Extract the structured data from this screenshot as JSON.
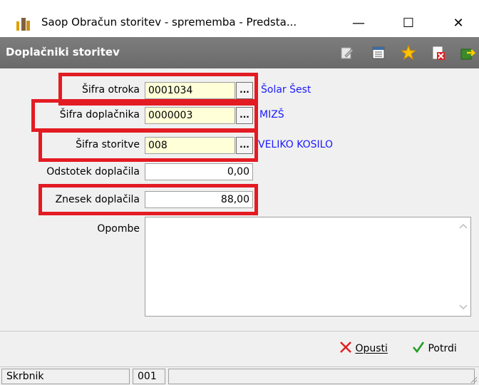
{
  "window": {
    "title": "Saop Obračun storitev - sprememba - Predsta...",
    "minimize": "—",
    "maximize": "☐",
    "close": "✕"
  },
  "header": {
    "title": "Doplačniki storitev",
    "toolbar_icons": [
      "edit-icon",
      "list-icon",
      "star-icon",
      "delete-document-icon",
      "exit-icon"
    ]
  },
  "form": {
    "child_code": {
      "label": "Šifra otroka",
      "value": "0001034",
      "lookup": "...",
      "description": "Šolar Šest"
    },
    "payer_code": {
      "label": "Šifra doplačnika",
      "value": "0000003",
      "lookup": "...",
      "description": "MIZŠ"
    },
    "service_code": {
      "label": "Šifra storitve",
      "value": "008",
      "lookup": "...",
      "description": "VELIKO KOSILO"
    },
    "surcharge_percent": {
      "label": "Odstotek doplačila",
      "value": "0,00"
    },
    "surcharge_amount": {
      "label": "Znesek doplačila",
      "value": "88,00"
    },
    "notes": {
      "label": "Opombe",
      "value": ""
    }
  },
  "buttons": {
    "cancel": "Opusti",
    "confirm": "Potrdi"
  },
  "statusbar": {
    "field1": "Skrbnik",
    "field2": "001",
    "field3": ""
  },
  "colors": {
    "highlight": "#e31b23",
    "description_text": "#1a1aff",
    "required_field": "#ffffd8"
  }
}
